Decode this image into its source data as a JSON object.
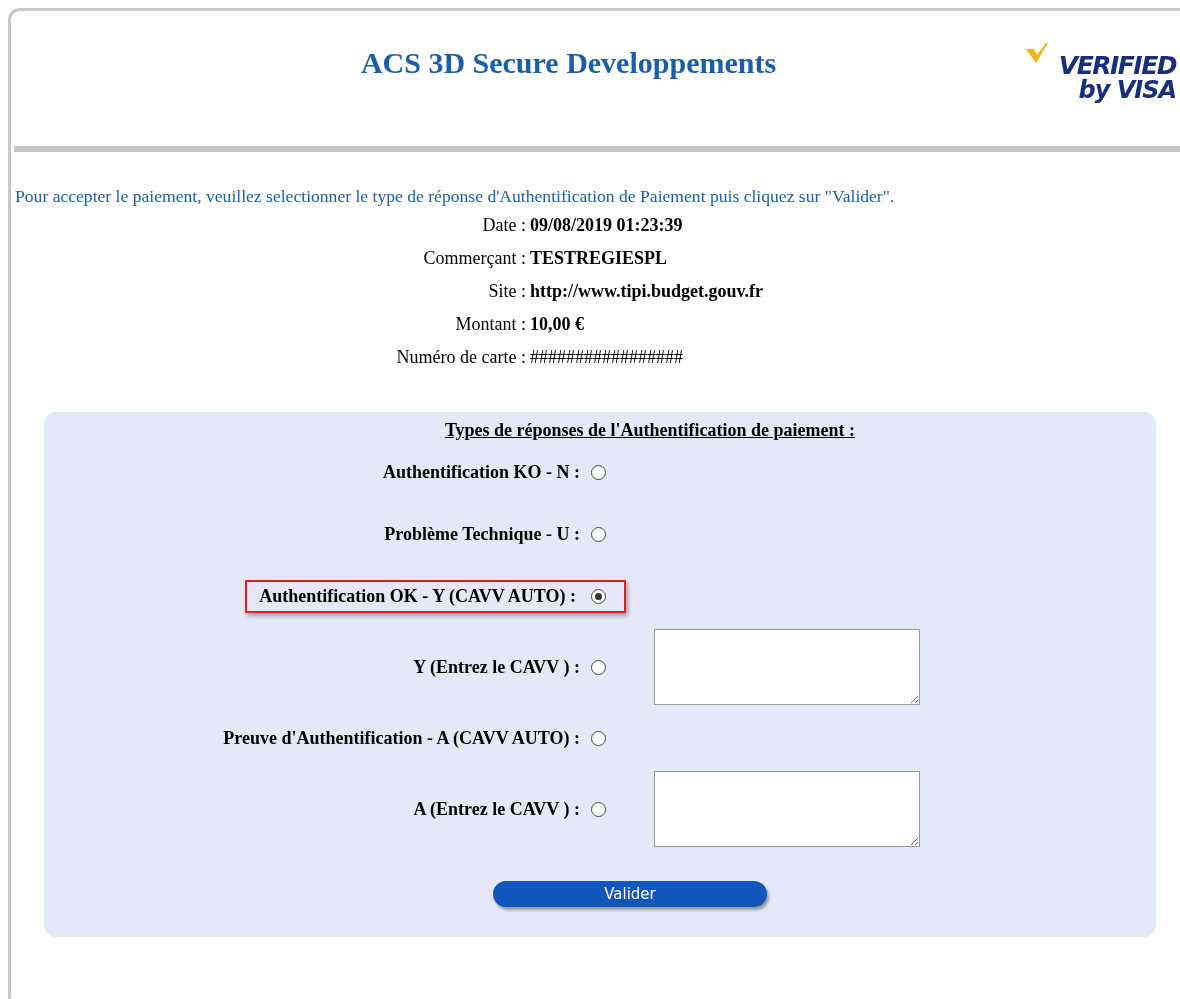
{
  "header": {
    "title": "ACS 3D Secure Developpements",
    "logo": {
      "top": "VERIFIED",
      "bottom": "by VISA"
    }
  },
  "intro": "Pour accepter le paiement, veuillez selectionner le type de réponse d'Authentification de Paiement puis cliquez sur \"Valider\".",
  "details": [
    {
      "label": "Date :",
      "value": "09/08/2019 01:23:39",
      "bold": true
    },
    {
      "label": "Commerçant :",
      "value": "TESTREGIESPL",
      "bold": true
    },
    {
      "label": "Site :",
      "value": "http://www.tipi.budget.gouv.fr",
      "bold": true
    },
    {
      "label": "Montant :",
      "value": "10,00 €",
      "bold": true
    },
    {
      "label": "Numéro de carte :",
      "value": "#################",
      "bold": false
    }
  ],
  "panel": {
    "heading": "Types de réponses de l'Authentification de paiement :",
    "options": [
      {
        "label": "Authentification KO - N :",
        "selected": false,
        "highlighted": false,
        "kind": "plain"
      },
      {
        "label": "Problème Technique - U :",
        "selected": false,
        "highlighted": false,
        "kind": "plain"
      },
      {
        "label": "Authentification OK - Y (CAVV AUTO) :",
        "selected": true,
        "highlighted": true,
        "kind": "plain"
      },
      {
        "label": "Y (Entrez le CAVV ) :",
        "selected": false,
        "highlighted": false,
        "kind": "textarea"
      },
      {
        "label": "Preuve d'Authentification - A (CAVV AUTO) :",
        "selected": false,
        "highlighted": false,
        "kind": "plain"
      },
      {
        "label": "A (Entrez le CAVV ) :",
        "selected": false,
        "highlighted": false,
        "kind": "textarea"
      }
    ],
    "button": "Valider"
  }
}
